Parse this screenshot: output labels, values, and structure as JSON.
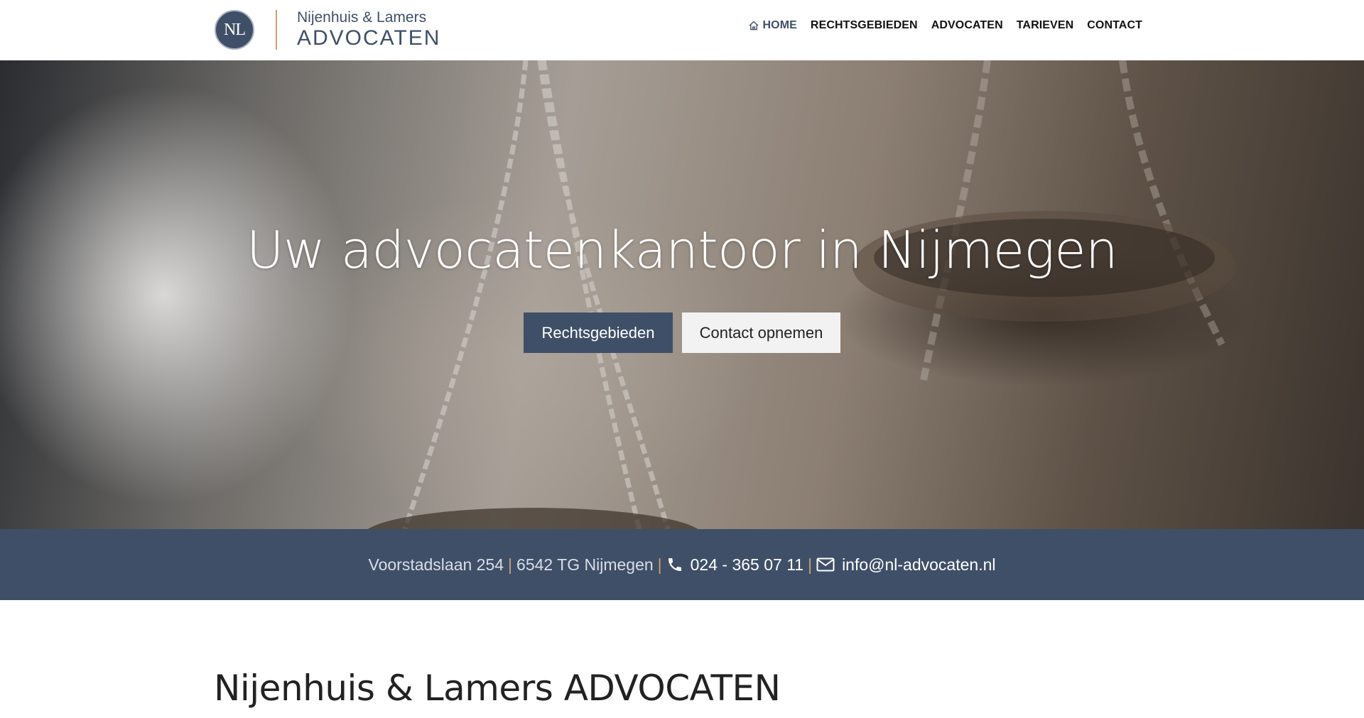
{
  "header": {
    "logo": {
      "badge_text": "NL",
      "line1": "Nijenhuis & Lamers",
      "line2": "ADVOCATEN"
    },
    "nav": [
      {
        "label": "HOME",
        "icon": "home-icon",
        "active": true
      },
      {
        "label": "RECHTSGEBIEDEN",
        "active": false
      },
      {
        "label": "ADVOCATEN",
        "active": false
      },
      {
        "label": "TARIEVEN",
        "active": false
      },
      {
        "label": "CONTACT",
        "active": false
      }
    ]
  },
  "hero": {
    "title": "Uw advocatenkantoor in Nijmegen",
    "primary_button": "Rechtsgebieden",
    "secondary_button": "Contact opnemen"
  },
  "infobar": {
    "address": "Voorstadslaan 254",
    "city": "6542 TG Nijmegen",
    "phone": "024 - 365 07 11",
    "phone_icon": "phone-icon",
    "email": "info@nl-advocaten.nl",
    "email_icon": "envelope-icon"
  },
  "intro": {
    "title": "Nijenhuis & Lamers ADVOCATEN"
  },
  "colors": {
    "brand": "#3f4f68",
    "accent": "#c9a26a"
  }
}
